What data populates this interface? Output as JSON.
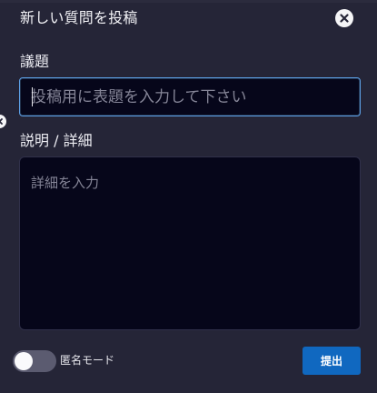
{
  "dialog": {
    "title": "新しい質問を投稿",
    "close_icon": "close-icon"
  },
  "subject": {
    "label": "議題",
    "value": "",
    "placeholder": "投稿用に表題を入力して下さい"
  },
  "detail": {
    "label": "説明 / 詳細",
    "value": "",
    "placeholder": "詳細を入力"
  },
  "anonymous": {
    "label": "匿名モード",
    "enabled": false
  },
  "submit": {
    "label": "提出"
  },
  "colors": {
    "background": "#252537",
    "input_background": "#06061a",
    "focus_border": "#5da0e6",
    "submit": "#1068c0",
    "toggle_off": "#5b5b70"
  }
}
